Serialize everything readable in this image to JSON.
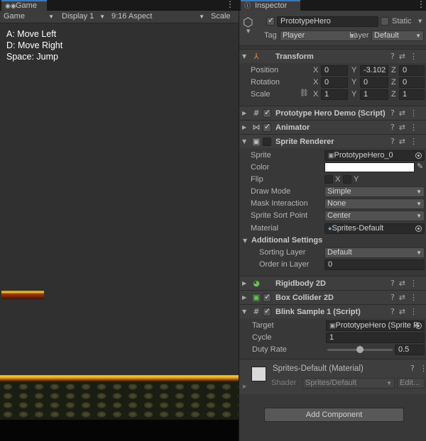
{
  "game_panel": {
    "tab_label": "Game",
    "toolbar": {
      "mode": "Game",
      "display": "Display 1",
      "aspect": "9:16 Aspect",
      "scale_label": "Scale"
    },
    "help_lines": [
      "A: Move Left",
      "D: Move Right",
      "Space: Jump"
    ]
  },
  "inspector": {
    "tab_label": "Inspector",
    "object_name": "PrototypeHero",
    "static_label": "Static",
    "tag_label": "Tag",
    "tag_value": "Player",
    "layer_label": "Layer",
    "layer_value": "Default",
    "transform": {
      "title": "Transform",
      "position_label": "Position",
      "rotation_label": "Rotation",
      "scale_label": "Scale",
      "axes": [
        "X",
        "Y",
        "Z"
      ],
      "position": [
        "0",
        "-3.102",
        "0"
      ],
      "rotation": [
        "0",
        "0",
        "0"
      ],
      "scale": [
        "1",
        "1",
        "1"
      ]
    },
    "prototype_demo": {
      "title": "Prototype Hero Demo (Script)"
    },
    "animator": {
      "title": "Animator"
    },
    "sprite_renderer": {
      "title": "Sprite Renderer",
      "sprite_label": "Sprite",
      "sprite_value": "PrototypeHero_0",
      "color_label": "Color",
      "color_value": "#ffffff",
      "flip_label": "Flip",
      "flip_x": "X",
      "flip_y": "Y",
      "draw_mode_label": "Draw Mode",
      "draw_mode_value": "Simple",
      "mask_label": "Mask Interaction",
      "mask_value": "None",
      "sort_point_label": "Sprite Sort Point",
      "sort_point_value": "Center",
      "material_label": "Material",
      "material_value": "Sprites-Default",
      "additional_title": "Additional Settings",
      "sorting_layer_label": "Sorting Layer",
      "sorting_layer_value": "Default",
      "order_label": "Order in Layer",
      "order_value": "0"
    },
    "rigidbody": {
      "title": "Rigidbody 2D"
    },
    "box_collider": {
      "title": "Box Collider 2D"
    },
    "blink_sample": {
      "title": "Blink Sample 1 (Script)",
      "target_label": "Target",
      "target_value": "PrototypeHero (Sprite R",
      "cycle_label": "Cycle",
      "cycle_value": "1",
      "duty_label": "Duty Rate",
      "duty_value": "0.5",
      "duty_fraction": 0.5
    },
    "material_preview": {
      "name": "Sprites-Default (Material)",
      "shader_label": "Shader",
      "shader_value": "Sprites/Default",
      "edit_label": "Edit..."
    },
    "add_component_label": "Add Component"
  }
}
